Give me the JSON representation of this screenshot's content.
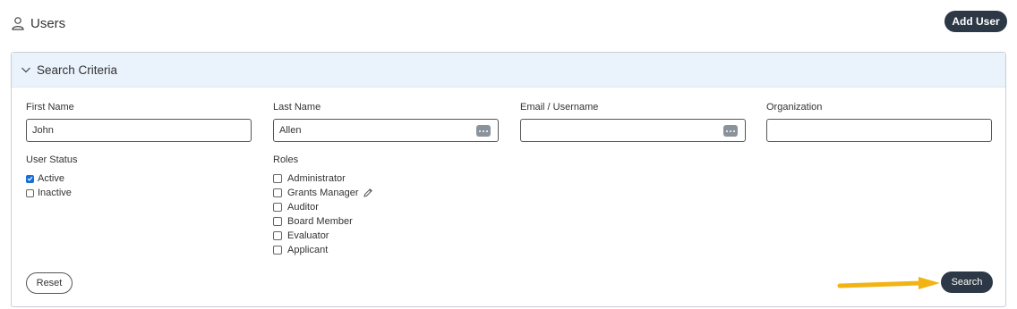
{
  "header": {
    "title": "Users",
    "icon": "user-icon",
    "add_user_label": "Add User"
  },
  "search_panel": {
    "title": "Search Criteria",
    "fields": {
      "first_name": {
        "label": "First Name",
        "value": "John"
      },
      "last_name": {
        "label": "Last Name",
        "value": "Allen"
      },
      "email": {
        "label": "Email / Username",
        "value": ""
      },
      "organization": {
        "label": "Organization",
        "value": ""
      }
    },
    "user_status": {
      "label": "User Status",
      "options": [
        {
          "label": "Active",
          "checked": true
        },
        {
          "label": "Inactive",
          "checked": false
        }
      ]
    },
    "roles": {
      "label": "Roles",
      "options": [
        {
          "label": "Administrator",
          "checked": false
        },
        {
          "label": "Grants Manager",
          "checked": false
        },
        {
          "label": "Auditor",
          "checked": false
        },
        {
          "label": "Board Member",
          "checked": false
        },
        {
          "label": "Evaluator",
          "checked": false
        },
        {
          "label": "Applicant",
          "checked": false
        }
      ]
    },
    "reset_label": "Reset",
    "search_label": "Search"
  },
  "colors": {
    "button_dark": "#2c3845",
    "header_bg": "#eaf2fb",
    "arrow": "#f2b413",
    "check": "#1a6fd6"
  }
}
